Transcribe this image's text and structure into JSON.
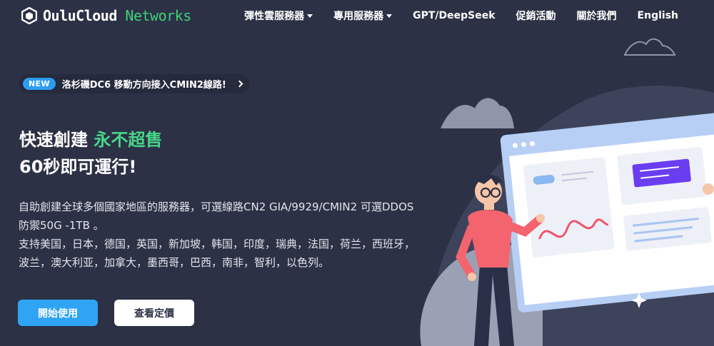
{
  "header": {
    "brand_primary": "OuluCloud",
    "brand_secondary": "Networks",
    "nav": [
      {
        "label": "彈性雲服務器",
        "has_dropdown": true
      },
      {
        "label": "專用服務器",
        "has_dropdown": true
      },
      {
        "label": "GPT/DeepSeek",
        "has_dropdown": false
      },
      {
        "label": "促銷活動",
        "has_dropdown": false
      },
      {
        "label": "關於我們",
        "has_dropdown": false
      },
      {
        "label": "English",
        "has_dropdown": false
      }
    ]
  },
  "announcement": {
    "badge": "NEW",
    "text": "洛杉磯DC6 移動方向接入CMIN2線路!"
  },
  "hero": {
    "title_part1": "快速創建 ",
    "title_highlight": "永不超售",
    "title_line2": "60秒即可運行!",
    "desc_line1": "自助創建全球多個國家地區的服務器，可選線路CN2 GIA/9929/CMIN2 可選DDOS 防禦50G -1TB 。",
    "desc_line2": "支持美国，日本，德国，英国，新加坡，韩国，印度，瑞典，法国，荷兰，西班牙，波兰，澳大利亚，加拿大，墨西哥，巴西，南非，智利，以色列。",
    "primary_button": "開始使用",
    "secondary_button": "查看定價"
  },
  "colors": {
    "background": "#2c3145",
    "accent_green": "#47d78a",
    "accent_blue": "#2fa4f5",
    "purple": "#6a3df0",
    "shirt": "#f4646f"
  }
}
